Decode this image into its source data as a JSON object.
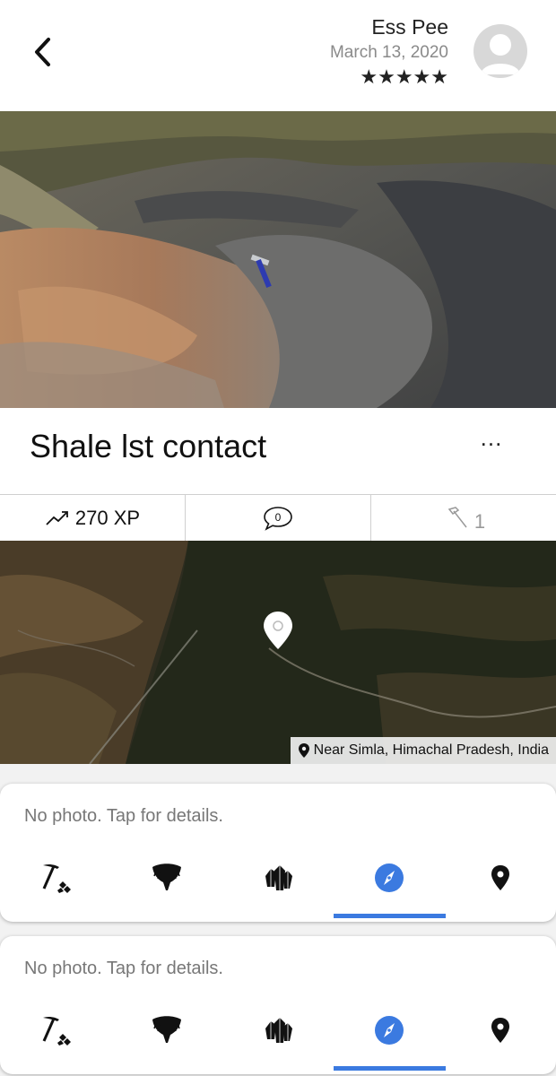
{
  "header": {
    "user_name": "Ess Pee",
    "date": "March 13, 2020",
    "rating_stars": "★★★★★"
  },
  "spot": {
    "title": "Shale lst contact",
    "more_label": "..."
  },
  "stats": {
    "xp": "270 XP",
    "comments": "0",
    "hammer_count": "1"
  },
  "map": {
    "location": "Near Simla, Himachal Pradesh, India"
  },
  "cards": [
    {
      "text": "No photo. Tap for details."
    },
    {
      "text": "No photo. Tap for details."
    }
  ],
  "tab_icons": [
    "pick-hammer-icon",
    "fossil-icon",
    "minerals-icon",
    "compass-icon",
    "location-pin-icon"
  ],
  "colors": {
    "accent": "#3b7ae0"
  }
}
